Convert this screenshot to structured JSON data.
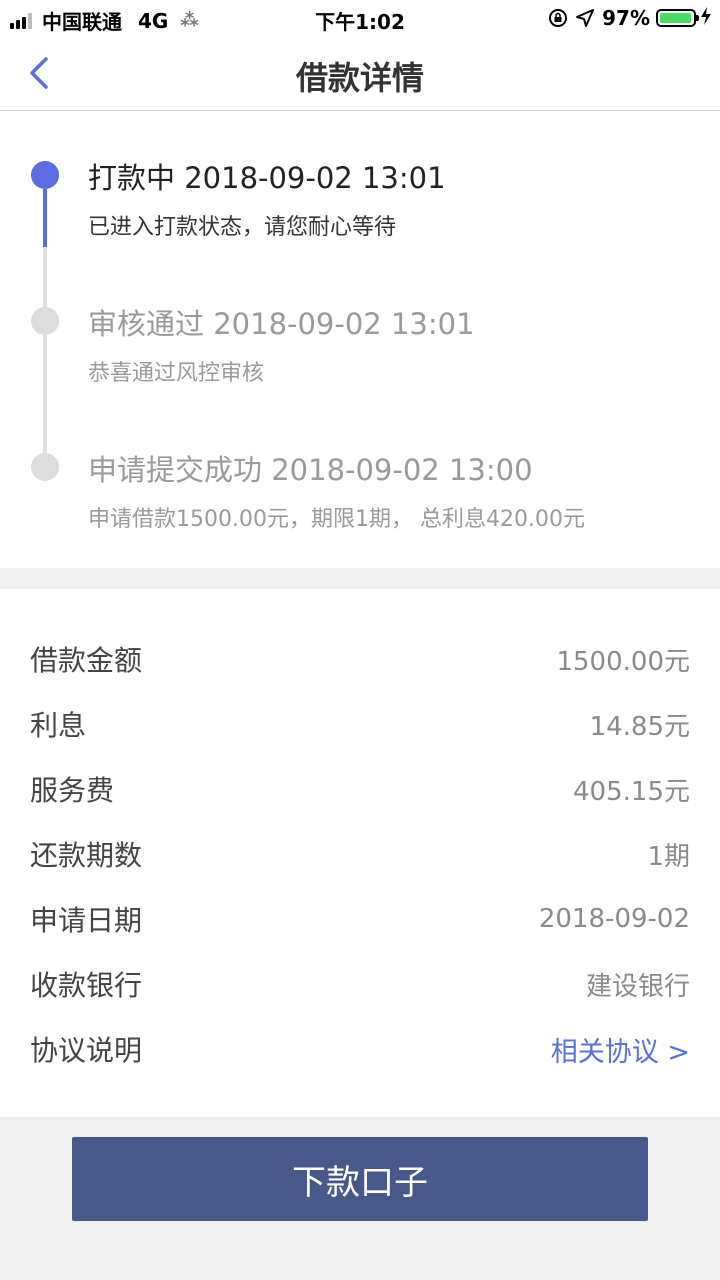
{
  "status_bar": {
    "carrier": "中国联通",
    "network": "4G",
    "time": "下午1:02",
    "battery_percent": "97%",
    "battery_level": 0.97
  },
  "nav": {
    "title": "借款详情",
    "back_icon": "chevron-left-icon"
  },
  "timeline": [
    {
      "title": "打款中 2018-09-02 13:01",
      "desc": "已进入打款状态，请您耐心等待",
      "active": true
    },
    {
      "title": "审核通过 2018-09-02 13:01",
      "desc": "恭喜通过风控审核",
      "active": false
    },
    {
      "title": "申请提交成功 2018-09-02 13:00",
      "desc": "申请借款1500.00元，期限1期， 总利息420.00元",
      "active": false
    }
  ],
  "details": [
    {
      "label": "借款金额",
      "value": "1500.00元"
    },
    {
      "label": "利息",
      "value": "14.85元"
    },
    {
      "label": "服务费",
      "value": "405.15元"
    },
    {
      "label": "还款期数",
      "value": "1期"
    },
    {
      "label": "申请日期",
      "value": "2018-09-02"
    },
    {
      "label": "收款银行",
      "value": "建设银行"
    },
    {
      "label": "协议说明",
      "value": "相关协议 >"
    }
  ],
  "action_button": {
    "label": "下款口子"
  },
  "colors": {
    "accent": "#5b6fd6",
    "active_dot": "#5b6be0",
    "inactive_dot": "#dcdcdc",
    "button_bg": "#475989",
    "battery": "#4cd964"
  }
}
